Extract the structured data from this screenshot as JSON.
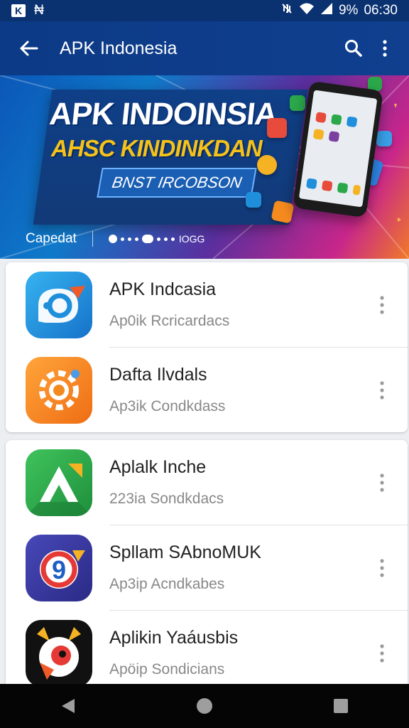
{
  "status_bar": {
    "left_badge": "K",
    "left_glyph": "₦",
    "battery": "9%",
    "time": "06:30"
  },
  "app_bar": {
    "title": "APK Indonesia",
    "back_icon": "arrow-left-icon",
    "search_icon": "search-icon",
    "menu_icon": "more-vert-icon"
  },
  "banner": {
    "headline": "APK INDOINSIA",
    "subheadline": "AHSC KINDINKDAN",
    "pill": "BNST IRCOBSON",
    "label": "Capedat",
    "counter": "IOGG"
  },
  "cards": [
    {
      "items": [
        {
          "name": "APK Indcasia",
          "subtitle": "Ap0ik Rcricardacs",
          "icon": "blue-chat-icon",
          "color": "#1f8fdc"
        },
        {
          "name": "Dafta Ilvdals",
          "subtitle": "Ap3ik Condkdass",
          "icon": "orange-gear-icon",
          "color": "#f38a1f"
        }
      ]
    },
    {
      "items": [
        {
          "name": "Aplalk Inche",
          "subtitle": "223ia Sondkdacs",
          "icon": "green-triangle-icon",
          "color": "#2aa84a"
        },
        {
          "name": "Spllam SAbnoMUK",
          "subtitle": "Ap3ip Acndkabes",
          "icon": "purple-g-icon",
          "color": "#3a3a9e"
        },
        {
          "name": "Aplikin Yaáusbis",
          "subtitle": "Apöip Sondicians",
          "icon": "black-bird-icon",
          "color": "#111111"
        }
      ]
    }
  ],
  "nav": {
    "back": "nav-back-icon",
    "home": "nav-home-icon",
    "recents": "nav-recents-icon"
  }
}
